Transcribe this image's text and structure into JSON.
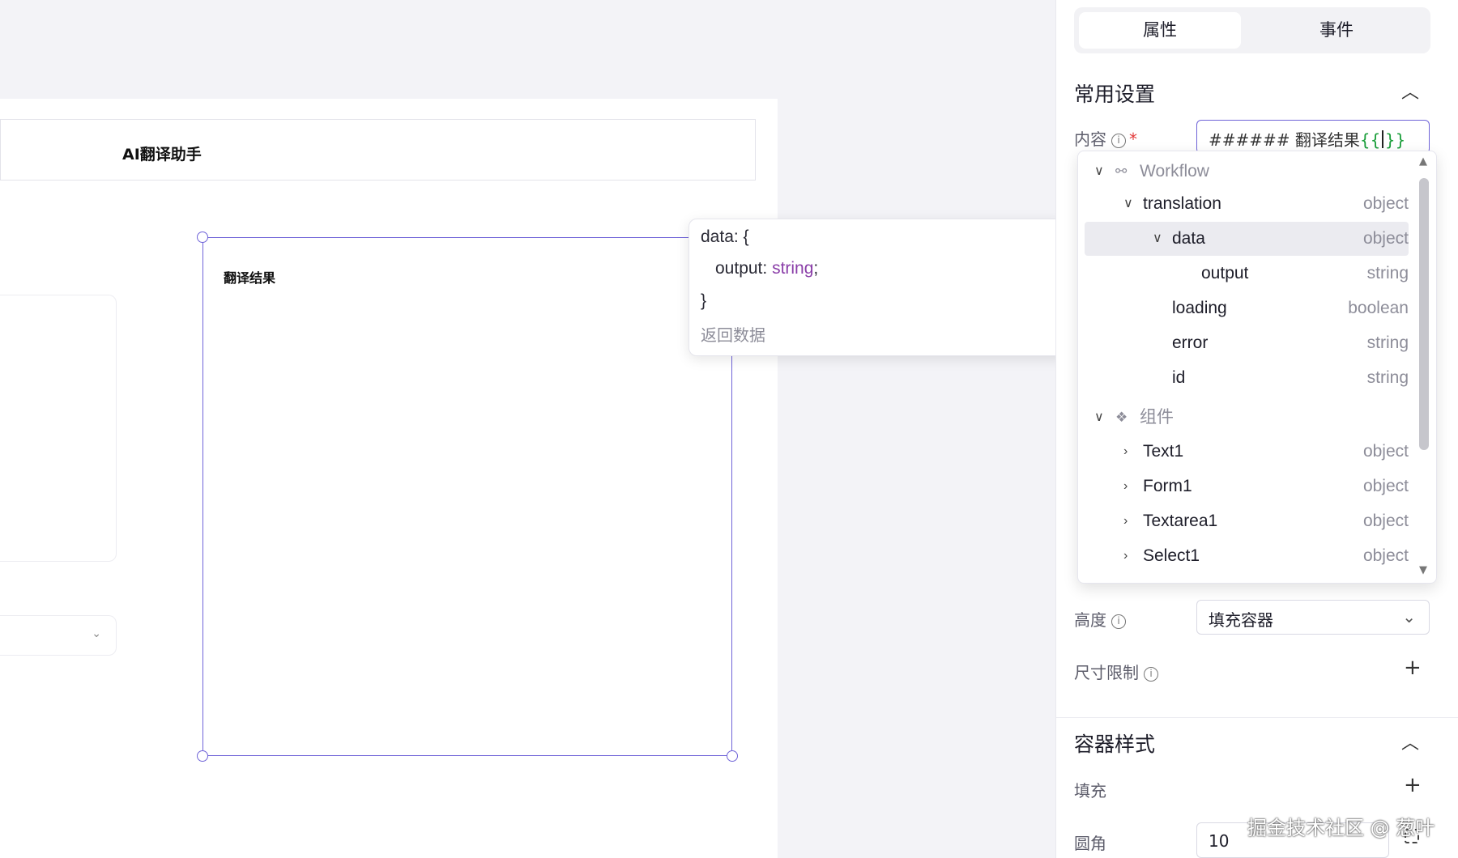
{
  "canvas": {
    "header_title": "AI翻译助手",
    "result_label": "翻译结果"
  },
  "tooltip": {
    "line1": "data: {",
    "line2_key": "output: ",
    "line2_type": "string",
    "line2_end": ";",
    "line3": "}",
    "description": "返回数据"
  },
  "panel": {
    "tabs": [
      "属性",
      "事件"
    ],
    "section_common": "常用设置",
    "content_label": "内容",
    "required_mark": "*",
    "content_value_prefix": "###### 翻译结果",
    "content_brace_open": "{{",
    "content_brace_close": "}}",
    "height_label": "高度",
    "height_value": "填充容器",
    "size_limit_label": "尺寸限制",
    "section_container": "容器样式",
    "fill_label": "填充",
    "radius_label": "圆角",
    "radius_value": "10"
  },
  "dropdown": {
    "groups": [
      {
        "label": "Workflow",
        "icon": "workflow-icon"
      },
      {
        "label": "组件",
        "icon": "component-icon"
      }
    ],
    "workflow_items": [
      {
        "name": "translation",
        "kind": "object"
      },
      {
        "name": "data",
        "kind": "object"
      },
      {
        "name": "output",
        "kind": "string"
      },
      {
        "name": "loading",
        "kind": "boolean"
      },
      {
        "name": "error",
        "kind": "string"
      },
      {
        "name": "id",
        "kind": "string"
      }
    ],
    "component_items": [
      {
        "name": "Text1",
        "kind": "object"
      },
      {
        "name": "Form1",
        "kind": "object"
      },
      {
        "name": "Textarea1",
        "kind": "object"
      },
      {
        "name": "Select1",
        "kind": "object"
      }
    ]
  },
  "watermark": "掘金技术社区 @ 葱叶"
}
